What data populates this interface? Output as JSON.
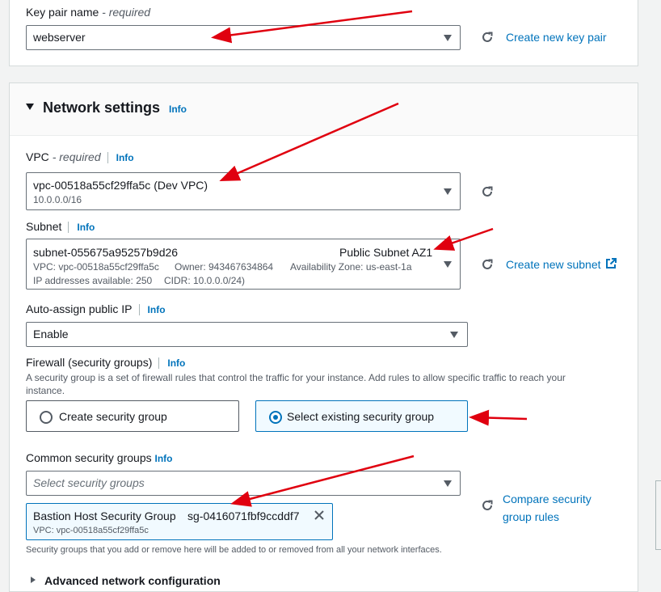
{
  "key_pair": {
    "label": "Key pair name",
    "required": "- required",
    "value": "webserver",
    "create_link": "Create new key pair"
  },
  "network": {
    "title": "Network settings",
    "info": "Info",
    "vpc": {
      "label": "VPC",
      "required": "- required",
      "info": "Info",
      "value": "vpc-00518a55cf29ffa5c (Dev VPC)",
      "cidr": "10.0.0.0/16"
    },
    "subnet": {
      "label": "Subnet",
      "info": "Info",
      "value": "subnet-055675a95257b9d26",
      "name": "Public Subnet AZ1",
      "vpc": "VPC: vpc-00518a55cf29ffa5c",
      "owner": "Owner: 943467634864",
      "az": "Availability Zone: us-east-1a",
      "ips": "IP addresses available: 250",
      "cidr": "CIDR: 10.0.0.0/24)",
      "create_link": "Create new subnet"
    },
    "auto_ip": {
      "label": "Auto-assign public IP",
      "info": "Info",
      "value": "Enable"
    },
    "firewall": {
      "label": "Firewall (security groups)",
      "info": "Info",
      "description": "A security group is a set of firewall rules that control the traffic for your instance. Add rules to allow specific traffic to reach your instance.",
      "option_create": "Create security group",
      "option_existing": "Select existing security group",
      "selected": "existing"
    },
    "common_sg": {
      "label": "Common security groups",
      "info": "Info",
      "placeholder": "Select security groups",
      "compare_link_line1": "Compare security",
      "compare_link_line2": "group rules",
      "token_name": "Bastion Host Security Group",
      "token_id": "sg-0416071fbf9ccddf7",
      "token_vpc": "VPC: vpc-00518a55cf29ffa5c",
      "hint": "Security groups that you add or remove here will be added to or removed from all your network interfaces."
    },
    "advanced": "Advanced network configuration"
  },
  "colors": {
    "accent": "#0073bb",
    "annotation_arrow": "#e0000f"
  }
}
